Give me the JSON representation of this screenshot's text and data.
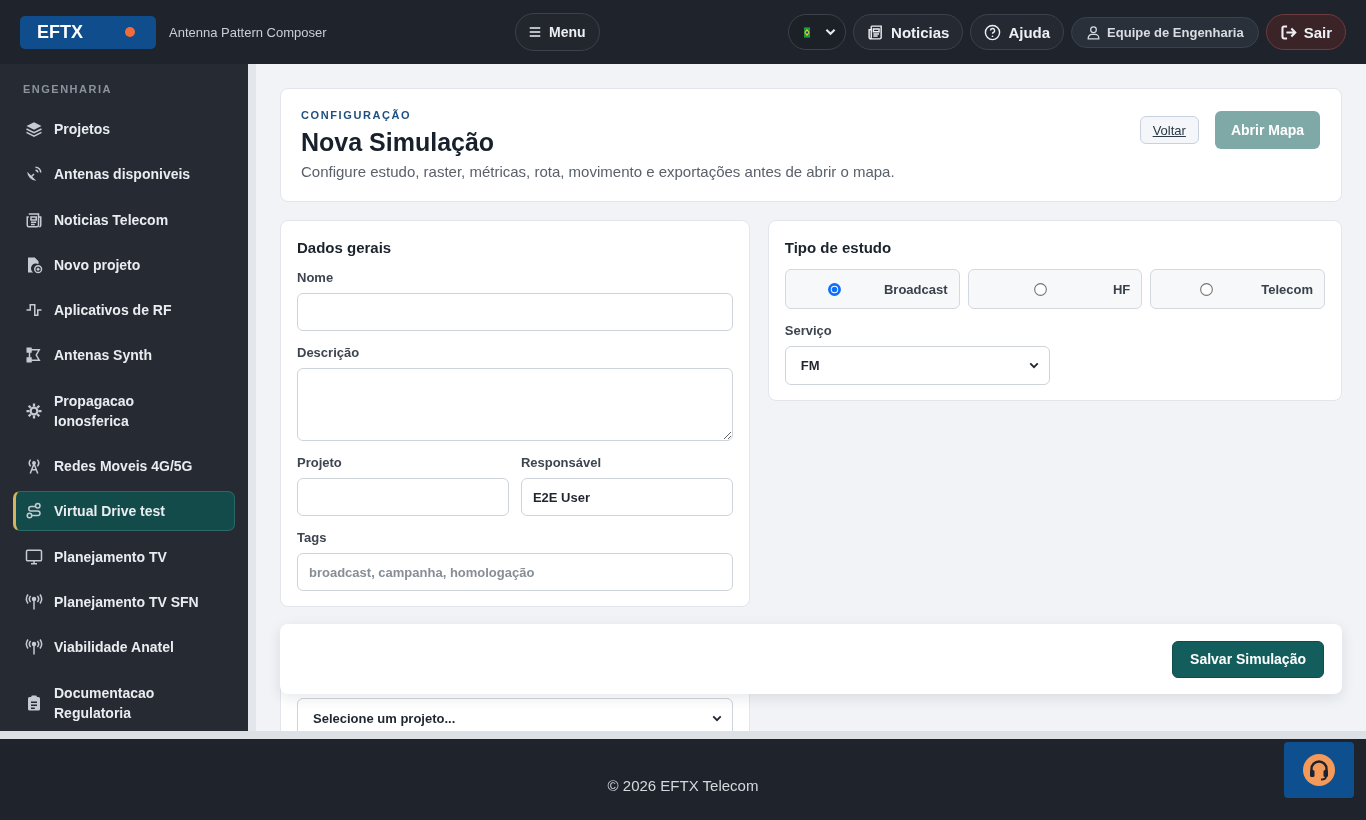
{
  "header": {
    "logo": "EFTX",
    "app_name": "Antenna Pattern Composer",
    "menu_button": "Menu",
    "news_button": "Noticias",
    "help_button": "Ajuda",
    "user_button": "Equipe de Engenharia",
    "logout_button": "Sair"
  },
  "sidebar": {
    "section_label": "ENGENHARIA",
    "items": [
      {
        "label": "Projetos",
        "selected": false
      },
      {
        "label": "Antenas disponiveis",
        "selected": false
      },
      {
        "label": "Noticias Telecom",
        "selected": false
      },
      {
        "label": "Novo projeto",
        "selected": false
      },
      {
        "label": "Aplicativos de RF",
        "selected": false
      },
      {
        "label": "Antenas Synth",
        "selected": false
      },
      {
        "label": "Propagacao Ionosferica",
        "selected": false
      },
      {
        "label": "Redes Moveis 4G/5G",
        "selected": false
      },
      {
        "label": "Virtual Drive test",
        "selected": true
      },
      {
        "label": "Planejamento TV",
        "selected": false
      },
      {
        "label": "Planejamento TV SFN",
        "selected": false
      },
      {
        "label": "Viabilidade Anatel",
        "selected": false
      },
      {
        "label": "Documentacao Regulatoria",
        "selected": false
      }
    ]
  },
  "page_header": {
    "eyebrow": "CONFIGURAÇÃO",
    "title": "Nova Simulação",
    "subtitle": "Configure estudo, raster, métricas, rota, movimento e exportações antes de abrir o mapa.",
    "back_button": "Voltar",
    "open_map_button": {
      "label": "Abrir Mapa",
      "disabled": true
    }
  },
  "general": {
    "title": "Dados gerais",
    "name_field": {
      "label": "Nome"
    },
    "description_field": {
      "label": "Descrição"
    },
    "project_field": {
      "label": "Projeto"
    },
    "owner_field": {
      "label": "Responsável",
      "value": "E2E User"
    },
    "tags_field": {
      "label": "Tags",
      "placeholder": "broadcast, campanha, homologação"
    }
  },
  "study": {
    "title": "Tipo de estudo",
    "options": [
      {
        "label": "Broadcast",
        "selected": true
      },
      {
        "label": "HF",
        "selected": false
      },
      {
        "label": "Telecom",
        "selected": false
      }
    ],
    "service_field": {
      "label": "Serviço",
      "value": "FM"
    }
  },
  "raster": {
    "saved_field": {
      "value": "Selecione um projeto..."
    }
  },
  "save_bar": {
    "save_button": "Salvar Simulação"
  },
  "footer": {
    "copyright": "© 2026 EFTX Telecom"
  }
}
